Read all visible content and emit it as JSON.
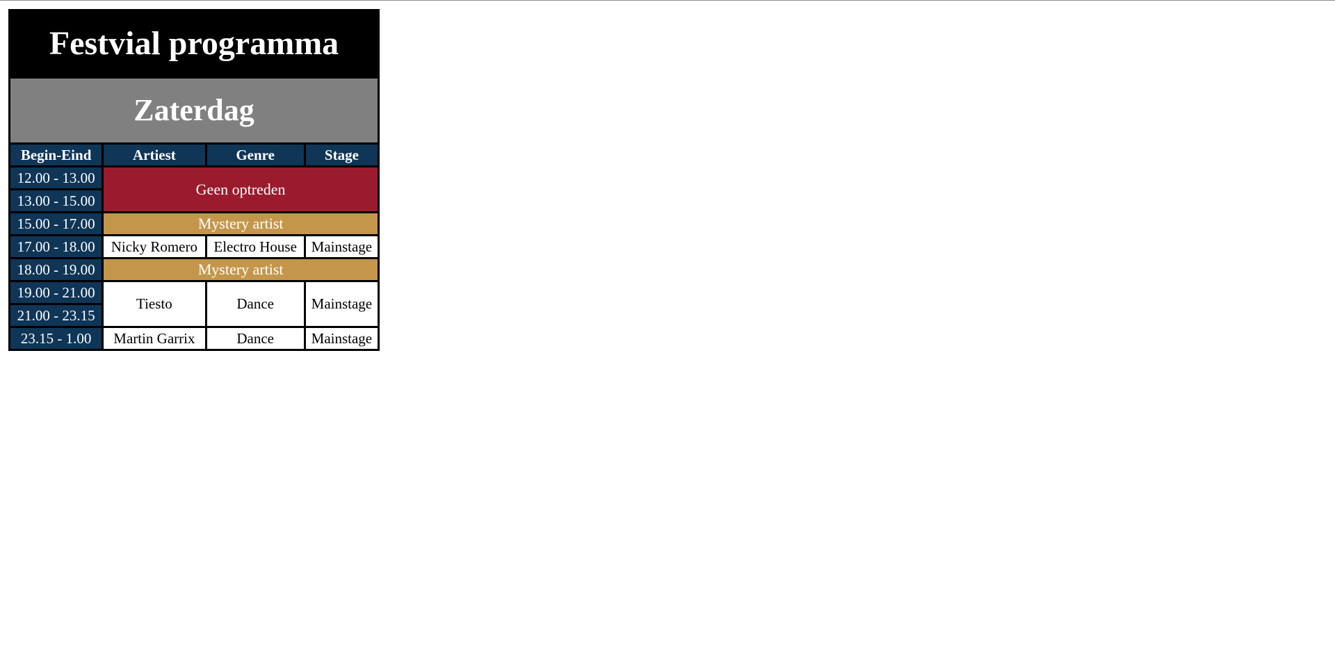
{
  "page": {
    "title": "Festvial programma",
    "day": "Zaterdag"
  },
  "columns": {
    "time": "Begin-Eind",
    "artist": "Artiest",
    "genre": "Genre",
    "stage": "Stage"
  },
  "rows": {
    "r1": {
      "time": "12.00 - 13.00"
    },
    "r2": {
      "time": "13.00 - 15.00"
    },
    "r3": {
      "time": "15.00 - 17.00"
    },
    "r4": {
      "time": "17.00 - 18.00",
      "artist": "Nicky Romero",
      "genre": "Electro House",
      "stage": "Mainstage"
    },
    "r5": {
      "time": "18.00 - 19.00"
    },
    "r6": {
      "time": "19.00 - 21.00",
      "artist": "Tiesto",
      "genre": "Dance",
      "stage": "Mainstage"
    },
    "r7": {
      "time": "21.00 - 23.15"
    },
    "r8": {
      "time": "23.15 - 1.00",
      "artist": "Martin Garrix",
      "genre": "Dance",
      "stage": "Mainstage"
    }
  },
  "blocks": {
    "no_performance": "Geen optreden",
    "mystery_1": "Mystery artist",
    "mystery_2": "Mystery artist"
  },
  "colors": {
    "title_bg": "#000000",
    "day_bg": "#808080",
    "header_bg": "#0f3557",
    "no_performance_bg": "#9b1b2e",
    "mystery_bg": "#c4964b",
    "text_light": "#ffffff",
    "text_dark": "#000000"
  }
}
